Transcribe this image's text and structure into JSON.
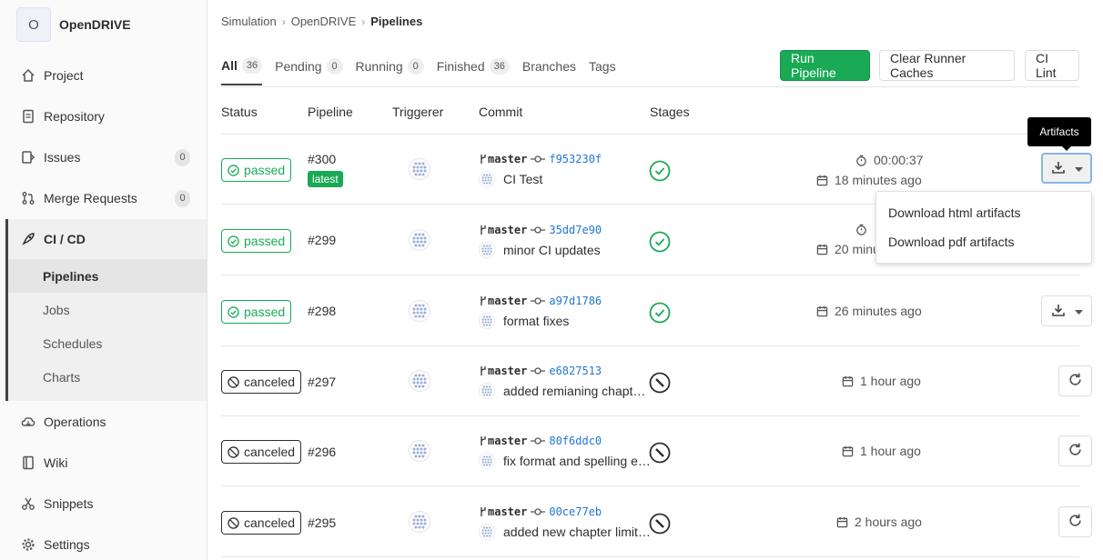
{
  "project": {
    "initial": "O",
    "name": "OpenDRIVE"
  },
  "sidebar": {
    "items": [
      {
        "label": "Project",
        "icon": "home-icon"
      },
      {
        "label": "Repository",
        "icon": "doc-icon"
      },
      {
        "label": "Issues",
        "icon": "issues-icon",
        "count": "0"
      },
      {
        "label": "Merge Requests",
        "icon": "merge-icon",
        "count": "0"
      },
      {
        "label": "CI / CD",
        "icon": "rocket-icon"
      },
      {
        "label": "Operations",
        "icon": "cloud-icon"
      },
      {
        "label": "Wiki",
        "icon": "book-icon"
      },
      {
        "label": "Snippets",
        "icon": "scissors-icon"
      },
      {
        "label": "Settings",
        "icon": "gear-icon"
      }
    ],
    "ci_sub": [
      "Pipelines",
      "Jobs",
      "Schedules",
      "Charts"
    ]
  },
  "breadcrumb": [
    "Simulation",
    "OpenDRIVE",
    "Pipelines"
  ],
  "tabs": [
    {
      "label": "All",
      "count": "36"
    },
    {
      "label": "Pending",
      "count": "0"
    },
    {
      "label": "Running",
      "count": "0"
    },
    {
      "label": "Finished",
      "count": "36"
    },
    {
      "label": "Branches"
    },
    {
      "label": "Tags"
    }
  ],
  "buttons": {
    "run": "Run Pipeline",
    "clear": "Clear Runner Caches",
    "lint": "CI Lint"
  },
  "columns": [
    "Status",
    "Pipeline",
    "Triggerer",
    "Commit",
    "Stages"
  ],
  "rows": [
    {
      "status": "passed",
      "id": "#300",
      "latest": "latest",
      "branch": "master",
      "sha": "f953230f",
      "msg": "CI Test",
      "duration": "00:00:37",
      "when": "18 minutes ago"
    },
    {
      "status": "passed",
      "id": "#299",
      "branch": "master",
      "sha": "35dd7e90",
      "msg": "minor CI updates",
      "when": "20 minu"
    },
    {
      "status": "passed",
      "id": "#298",
      "branch": "master",
      "sha": "a97d1786",
      "msg": "format fixes",
      "when": "26 minutes ago"
    },
    {
      "status": "canceled",
      "id": "#297",
      "branch": "master",
      "sha": "e6827513",
      "msg": "added remianing chapt…",
      "when": "1 hour ago"
    },
    {
      "status": "canceled",
      "id": "#296",
      "branch": "master",
      "sha": "80f6ddc0",
      "msg": "fix format and spelling e…",
      "when": "1 hour ago"
    },
    {
      "status": "canceled",
      "id": "#295",
      "branch": "master",
      "sha": "00ce77eb",
      "msg": "added new chapter limit…",
      "when": "2 hours ago"
    }
  ],
  "tooltip": "Artifacts",
  "artifacts_menu": [
    "Download html artifacts",
    "Download pdf artifacts"
  ],
  "colors": {
    "green": "#1aaa55",
    "link": "#1f78d1"
  }
}
